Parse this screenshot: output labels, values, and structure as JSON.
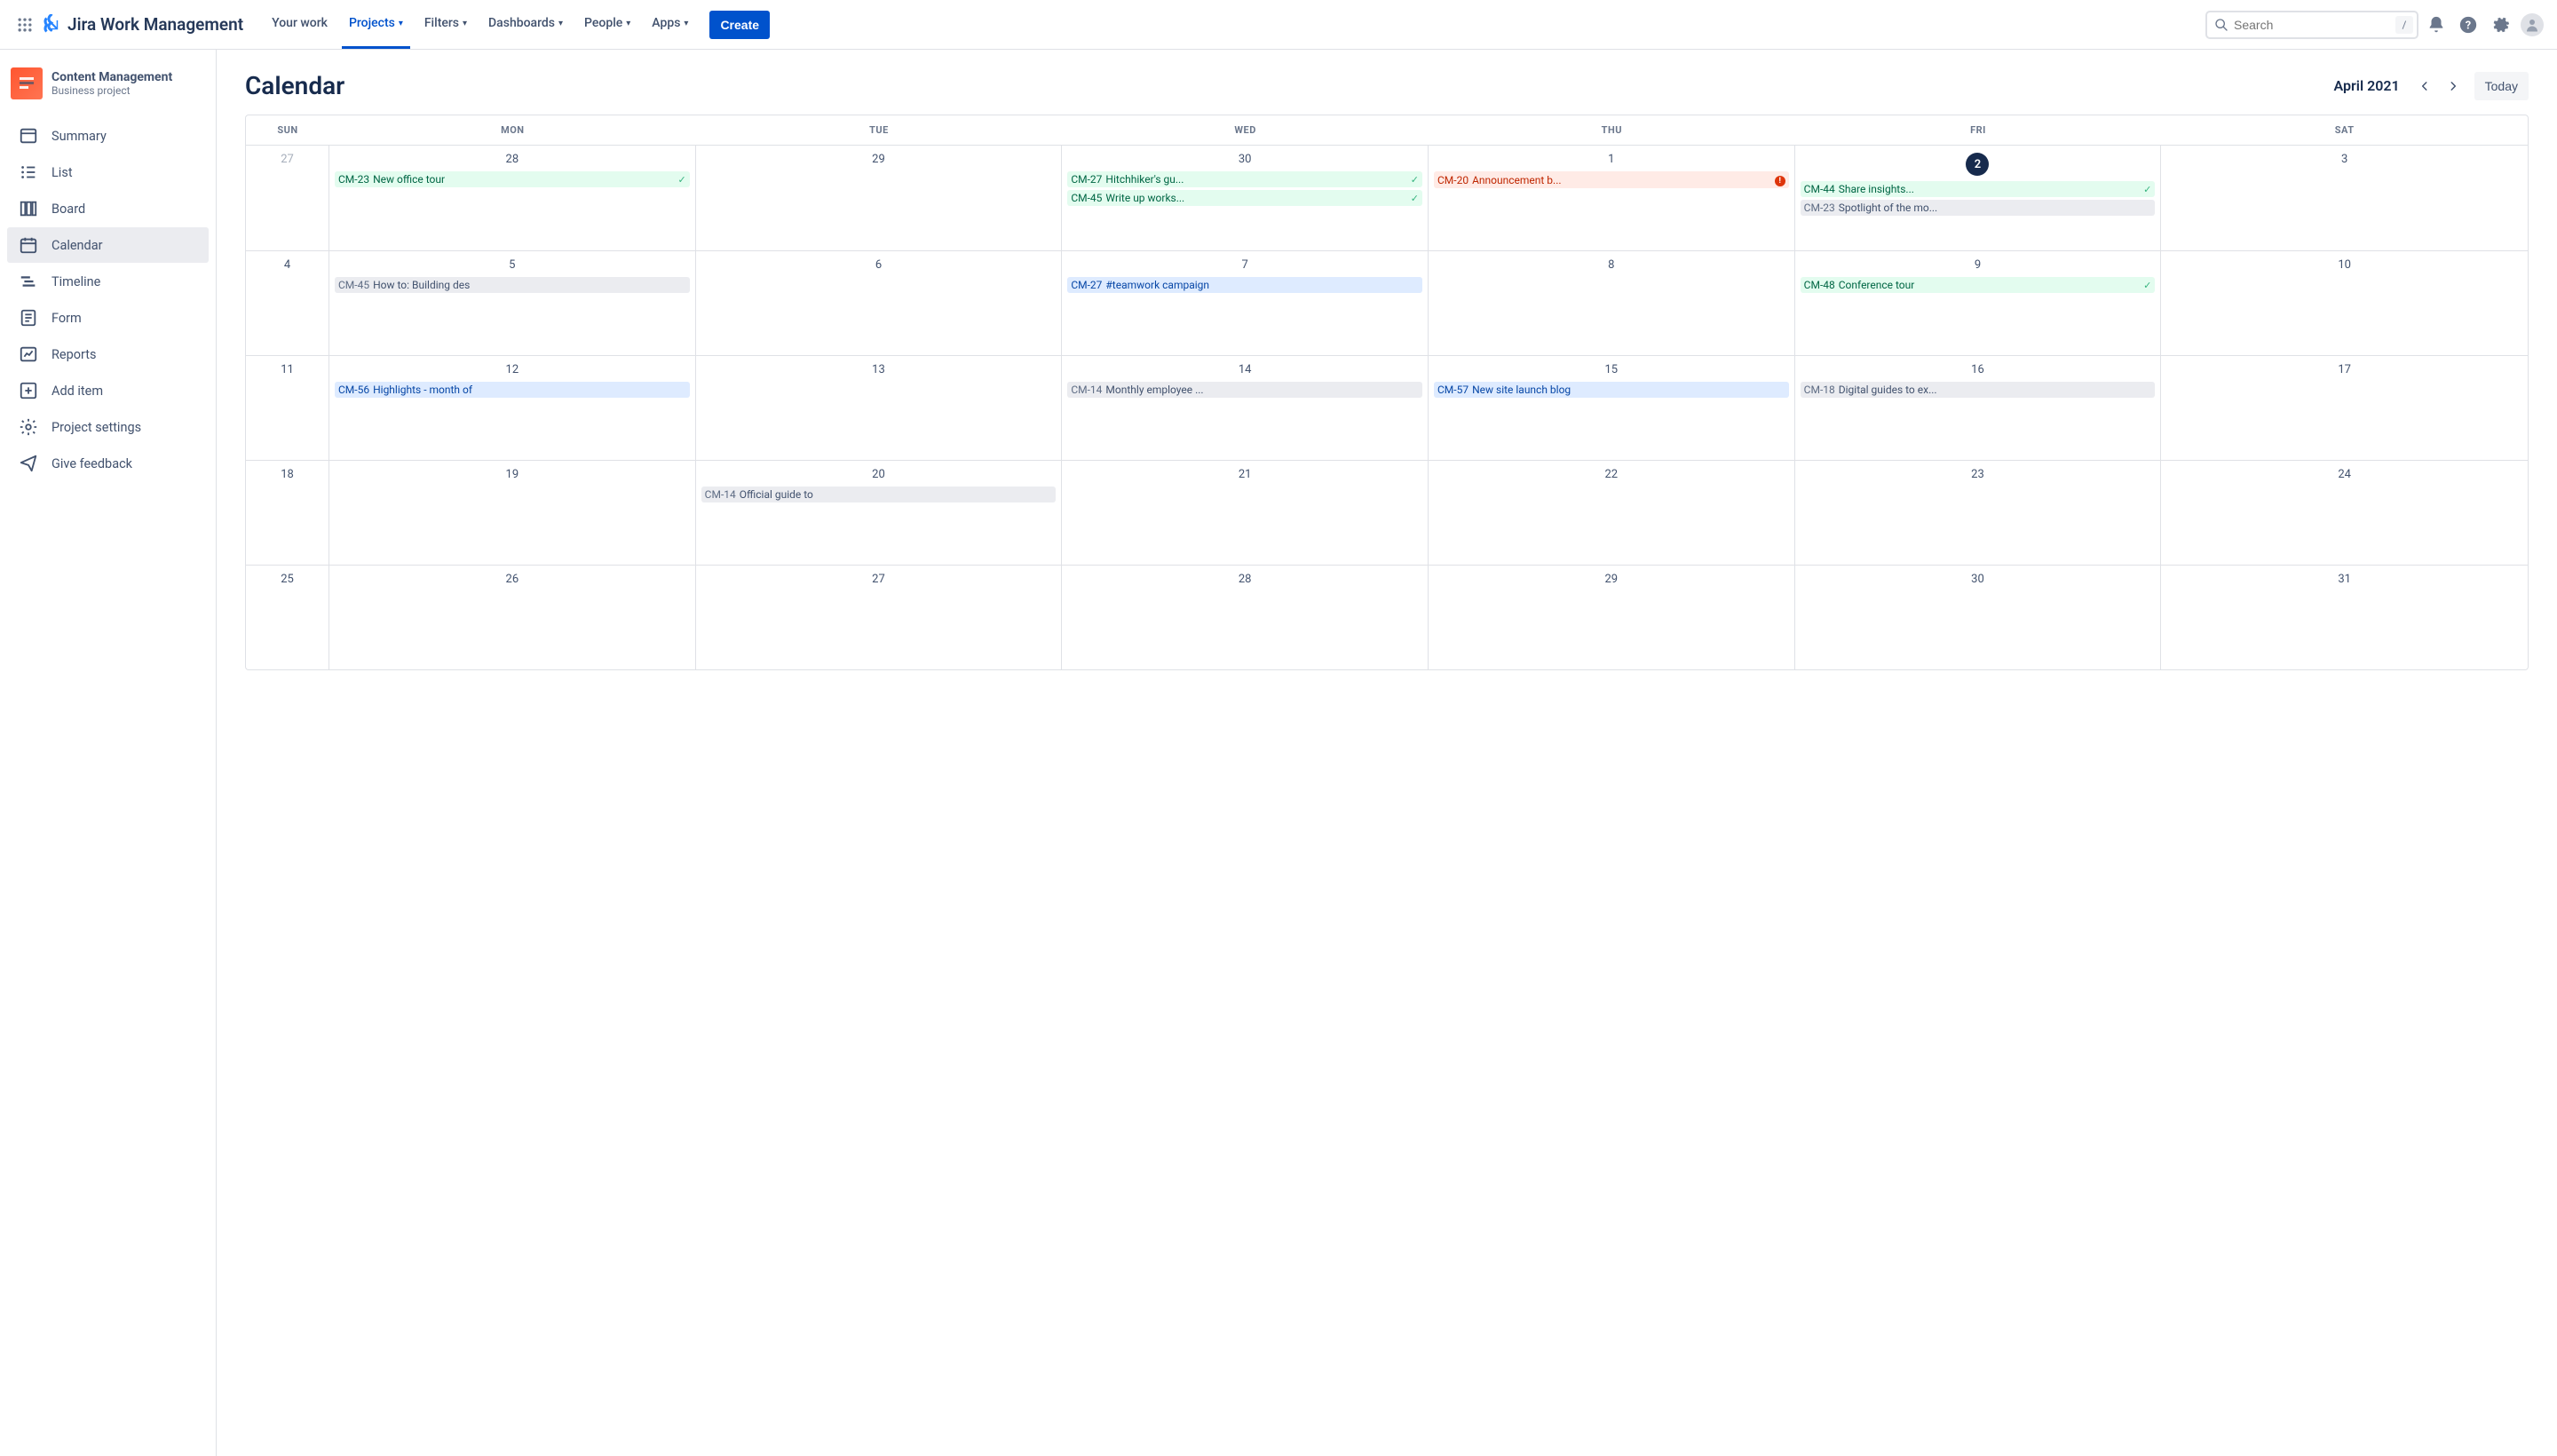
{
  "topnav": {
    "product_name": "Jira Work Management",
    "items": [
      {
        "label": "Your work",
        "dropdown": false
      },
      {
        "label": "Projects",
        "dropdown": true,
        "selected": true
      },
      {
        "label": "Filters",
        "dropdown": true
      },
      {
        "label": "Dashboards",
        "dropdown": true
      },
      {
        "label": "People",
        "dropdown": true
      },
      {
        "label": "Apps",
        "dropdown": true
      }
    ],
    "create_label": "Create",
    "search_placeholder": "Search",
    "search_hint": "/"
  },
  "project": {
    "name": "Content Management",
    "type": "Business project"
  },
  "sidebar": {
    "items": [
      {
        "icon": "summary",
        "label": "Summary"
      },
      {
        "icon": "list",
        "label": "List"
      },
      {
        "icon": "board",
        "label": "Board"
      },
      {
        "icon": "calendar",
        "label": "Calendar",
        "selected": true
      },
      {
        "icon": "timeline",
        "label": "Timeline"
      },
      {
        "icon": "form",
        "label": "Form"
      },
      {
        "icon": "reports",
        "label": "Reports"
      },
      {
        "icon": "add",
        "label": "Add item"
      },
      {
        "icon": "settings",
        "label": "Project settings"
      },
      {
        "icon": "feedback",
        "label": "Give feedback"
      }
    ]
  },
  "calendar": {
    "title": "Calendar",
    "month": "April 2021",
    "today_label": "Today",
    "dow": [
      "SUN",
      "MON",
      "TUE",
      "WED",
      "THU",
      "FRI",
      "SAT"
    ],
    "weeks": [
      {
        "days": [
          {
            "num": "27",
            "outside": true
          },
          {
            "num": "28",
            "items": [
              {
                "key": "CM-23",
                "text": "New office tour",
                "color": "green",
                "status": "check"
              }
            ]
          },
          {
            "num": "29"
          },
          {
            "num": "30",
            "items": [
              {
                "key": "CM-27",
                "text": "Hitchhiker's gu...",
                "color": "green",
                "status": "check"
              },
              {
                "key": "CM-45",
                "text": "Write up works...",
                "color": "green",
                "status": "check"
              }
            ]
          },
          {
            "num": "1",
            "items": [
              {
                "key": "CM-20",
                "text": "Announcement b...",
                "color": "red",
                "status": "alert"
              }
            ]
          },
          {
            "num": "2",
            "today": true,
            "items": [
              {
                "key": "CM-44",
                "text": "Share insights...",
                "color": "green",
                "status": "check"
              },
              {
                "key": "CM-23",
                "text": "Spotlight of the mo...",
                "color": "gray"
              }
            ]
          },
          {
            "num": "3"
          }
        ]
      },
      {
        "days": [
          {
            "num": "4"
          },
          {
            "num": "5",
            "items": [
              {
                "key": "CM-45",
                "text": "How to: Building des",
                "color": "gray"
              }
            ]
          },
          {
            "num": "6"
          },
          {
            "num": "7",
            "items": [
              {
                "key": "CM-27",
                "text": "#teamwork campaign",
                "color": "blue"
              }
            ]
          },
          {
            "num": "8"
          },
          {
            "num": "9",
            "items": [
              {
                "key": "CM-48",
                "text": "Conference tour",
                "color": "green",
                "status": "check"
              }
            ]
          },
          {
            "num": "10"
          }
        ]
      },
      {
        "days": [
          {
            "num": "11"
          },
          {
            "num": "12",
            "items": [
              {
                "key": "CM-56",
                "text": "Highlights - month of",
                "color": "blue"
              }
            ]
          },
          {
            "num": "13"
          },
          {
            "num": "14",
            "items": [
              {
                "key": "CM-14",
                "text": "Monthly employee ...",
                "color": "gray"
              }
            ]
          },
          {
            "num": "15",
            "items": [
              {
                "key": "CM-57",
                "text": "New site launch blog",
                "color": "blue"
              }
            ]
          },
          {
            "num": "16",
            "items": [
              {
                "key": "CM-18",
                "text": "Digital guides to ex...",
                "color": "gray"
              }
            ]
          },
          {
            "num": "17"
          }
        ]
      },
      {
        "days": [
          {
            "num": "18"
          },
          {
            "num": "19"
          },
          {
            "num": "20",
            "items": [
              {
                "key": "CM-14",
                "text": "Official guide to",
                "color": "gray"
              }
            ]
          },
          {
            "num": "21"
          },
          {
            "num": "22"
          },
          {
            "num": "23"
          },
          {
            "num": "24"
          }
        ]
      },
      {
        "days": [
          {
            "num": "25"
          },
          {
            "num": "26"
          },
          {
            "num": "27"
          },
          {
            "num": "28"
          },
          {
            "num": "29"
          },
          {
            "num": "30"
          },
          {
            "num": "31"
          }
        ]
      }
    ]
  }
}
